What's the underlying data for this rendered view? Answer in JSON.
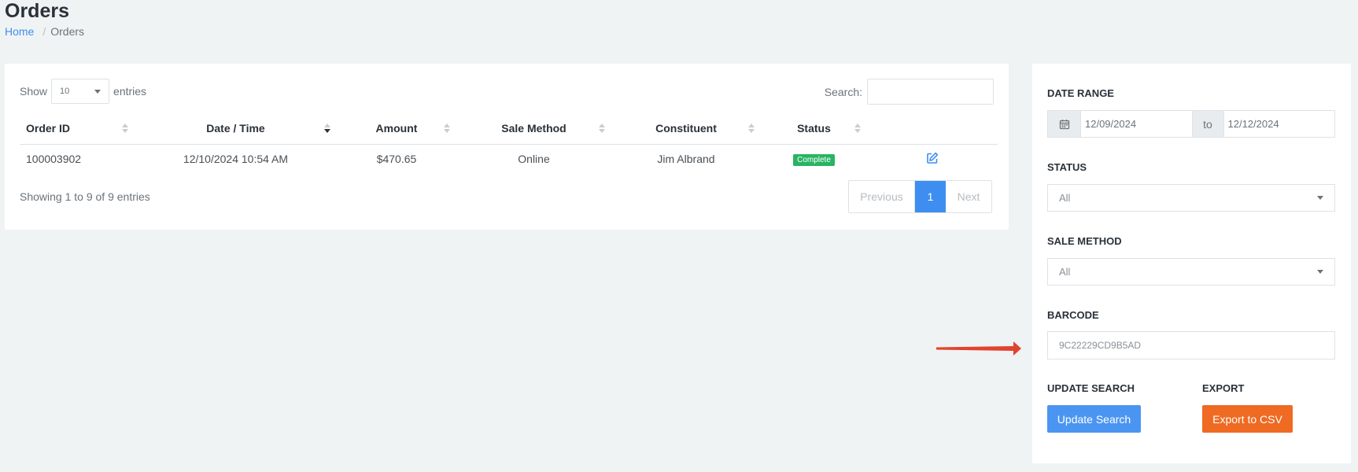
{
  "page": {
    "title": "Orders",
    "breadcrumb": {
      "home": "Home",
      "separator": "/",
      "current": "Orders"
    }
  },
  "table": {
    "show_label": "Show",
    "entries_value": "10",
    "entries_label": "entries",
    "search_label": "Search:",
    "search_value": "",
    "columns": [
      "Order ID",
      "Date / Time",
      "Amount",
      "Sale Method",
      "Constituent",
      "Status"
    ],
    "rows": [
      {
        "order_id": "100003902",
        "date_time": "12/10/2024 10:54 AM",
        "amount": "$470.65",
        "sale_method": "Online",
        "constituent": "Jim Albrand",
        "status": "Complete"
      }
    ],
    "info": "Showing 1 to 9 of 9 entries",
    "pagination": {
      "previous": "Previous",
      "current": "1",
      "next": "Next"
    }
  },
  "filters": {
    "date_range_label": "DATE RANGE",
    "date_from": "12/09/2024",
    "date_to_label": "to",
    "date_to": "12/12/2024",
    "status_label": "STATUS",
    "status_value": "All",
    "sale_method_label": "SALE METHOD",
    "sale_method_value": "All",
    "barcode_label": "BARCODE",
    "barcode_value": "9C22229CD9B5AD",
    "update_label": "UPDATE SEARCH",
    "update_button": "Update Search",
    "export_label": "EXPORT",
    "export_button": "Export to CSV"
  },
  "colors": {
    "accent": "#3d8ef0",
    "status_complete": "#28b463",
    "export": "#ef6a22",
    "annotation_arrow": "#e0442e"
  }
}
